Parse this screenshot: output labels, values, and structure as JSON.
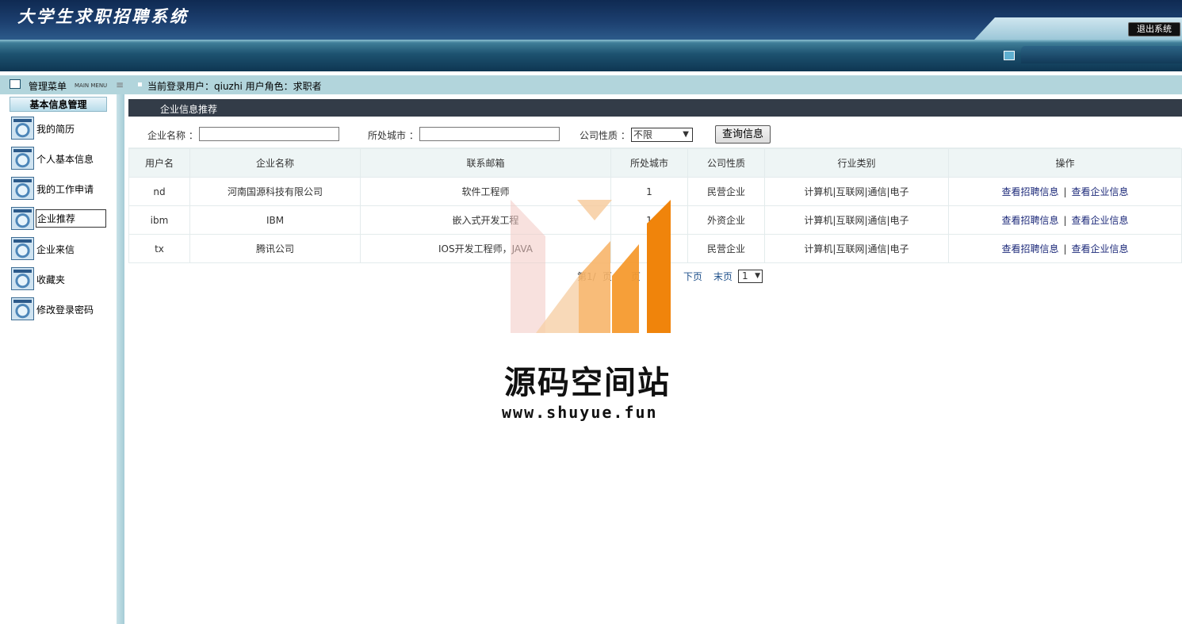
{
  "header": {
    "app_title": "大学生求职招聘系统",
    "logout_label": "退出系统"
  },
  "strip": {
    "menu_title": "管理菜单",
    "menu_subtitle": "MAIN MENU",
    "user_info": "当前登录用户：qiuzhi  用户角色：求职者"
  },
  "sidebar": {
    "group_title": "基本信息管理",
    "items": [
      {
        "label": "我的简历"
      },
      {
        "label": "个人基本信息"
      },
      {
        "label": "我的工作申请"
      },
      {
        "label": "企业推荐"
      },
      {
        "label": "企业来信"
      },
      {
        "label": "收藏夹"
      },
      {
        "label": "修改登录密码"
      }
    ]
  },
  "main": {
    "section_title": "企业信息推荐",
    "filter": {
      "company_label": "企业名称 ：",
      "company_value": "",
      "city_label": "所处城市 ：",
      "city_value": "",
      "nature_label": "公司性质 ：",
      "nature_selected": "不限",
      "search_label": "查询信息"
    },
    "table": {
      "headers": [
        "用户名",
        "企业名称",
        "联系邮箱",
        "所处城市",
        "公司性质",
        "行业类别",
        "操作"
      ],
      "rows": [
        {
          "user": "nd",
          "company": "河南国源科技有限公司",
          "email": "软件工程师",
          "city": "1",
          "nature": "民营企业",
          "industry": "计算机|互联网|通信|电子"
        },
        {
          "user": "ibm",
          "company": "IBM",
          "email": "嵌入式开发工程",
          "city": "1",
          "nature": "外资企业",
          "industry": "计算机|互联网|通信|电子"
        },
        {
          "user": "tx",
          "company": "腾讯公司",
          "email": "IOS开发工程师，JAVA",
          "city": "",
          "nature": "民营企业",
          "industry": "计算机|互联网|通信|电子"
        }
      ],
      "action_jobs": "查看招聘信息",
      "action_separator": "|",
      "action_company": "查看企业信息"
    },
    "pager": {
      "info": "第1/",
      "page_suffix": "页",
      "prev_tail": "页",
      "next": "下页",
      "last": "末页",
      "page_select": "1"
    }
  },
  "watermark": {
    "name": "源码空间站",
    "url": "www.shuyue.fun"
  }
}
